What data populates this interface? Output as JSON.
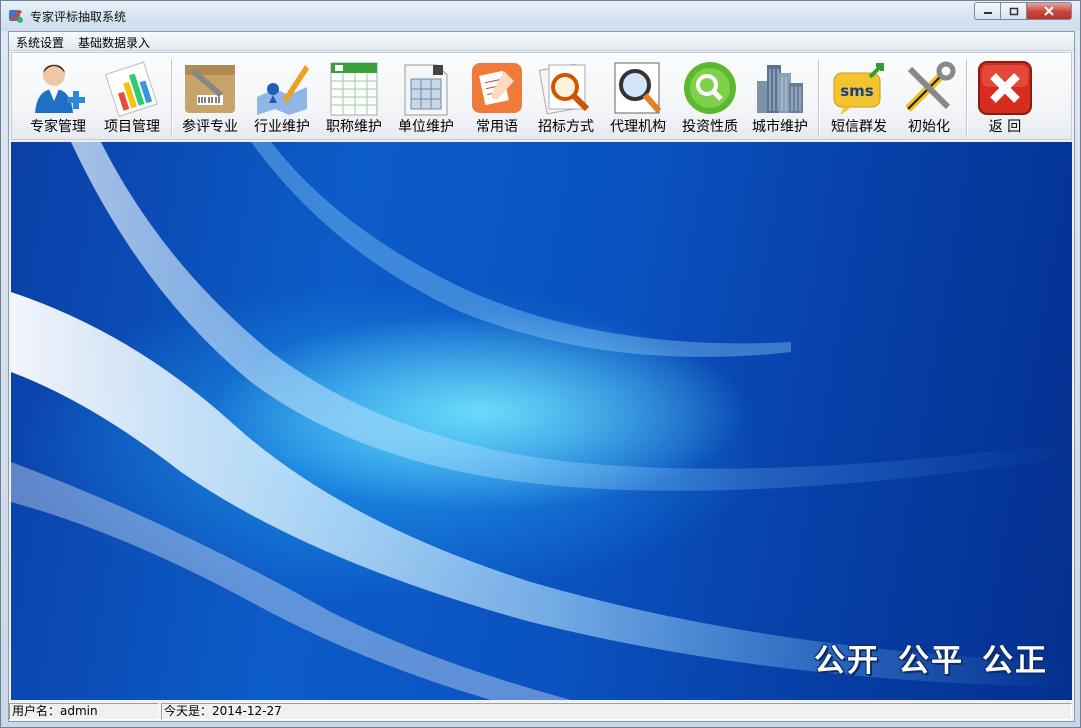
{
  "window": {
    "title": "专家评标抽取系统"
  },
  "menu": {
    "items": [
      "系统设置",
      "基础数据录入"
    ]
  },
  "toolbar": {
    "buttons": [
      {
        "label": "专家管理",
        "icon": "user-add-icon"
      },
      {
        "label": "项目管理",
        "icon": "chart-icon"
      },
      {
        "label": "参评专业",
        "icon": "wrench-box-icon"
      },
      {
        "label": "行业维护",
        "icon": "map-pen-icon"
      },
      {
        "label": "职称维护",
        "icon": "spreadsheet-icon"
      },
      {
        "label": "单位维护",
        "icon": "document-grid-icon"
      },
      {
        "label": "常用语",
        "icon": "notepad-icon"
      },
      {
        "label": "招标方式",
        "icon": "search-documents-icon"
      },
      {
        "label": "代理机构",
        "icon": "magnifier-icon"
      },
      {
        "label": "投资性质",
        "icon": "green-search-icon"
      },
      {
        "label": "城市维护",
        "icon": "buildings-icon"
      },
      {
        "label": "短信群发",
        "icon": "sms-icon"
      },
      {
        "label": "初始化",
        "icon": "tools-icon"
      },
      {
        "label": "返  回",
        "icon": "exit-icon"
      }
    ]
  },
  "slogan": [
    "公开",
    "公平",
    "公正"
  ],
  "status": {
    "user": "用户名：admin",
    "date": "今天是：2014-12-27"
  }
}
